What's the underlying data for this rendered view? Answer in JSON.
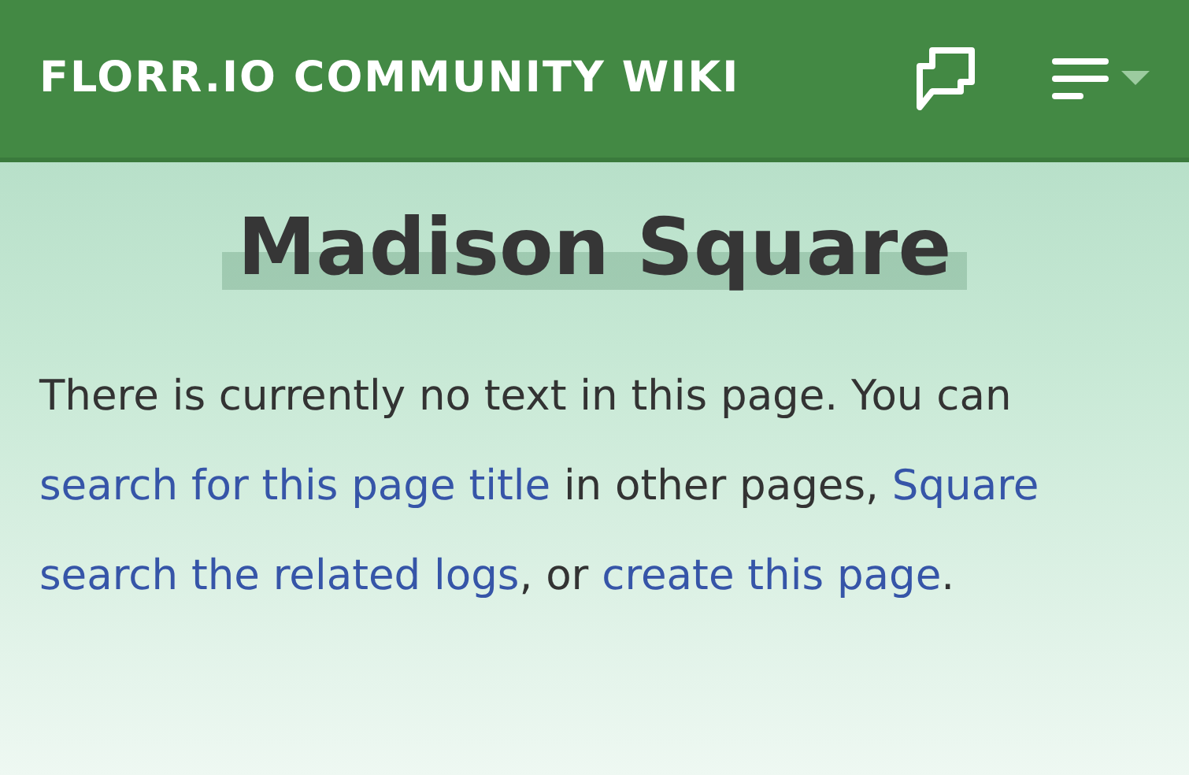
{
  "header": {
    "site_title": "FLORR.IO COMMUNITY WIKI"
  },
  "page_title": "Madison Square",
  "message": [
    {
      "kind": "text",
      "text": "There is currently no text in this page. You can "
    },
    {
      "kind": "link",
      "text": "search for this page title"
    },
    {
      "kind": "text",
      "text": " in other pages, "
    },
    {
      "kind": "link",
      "text": "Square"
    },
    {
      "kind": "link",
      "text": "search the related logs"
    },
    {
      "kind": "text",
      "text": ", or "
    },
    {
      "kind": "link",
      "text": "create this page"
    },
    {
      "kind": "text",
      "text": "."
    }
  ]
}
